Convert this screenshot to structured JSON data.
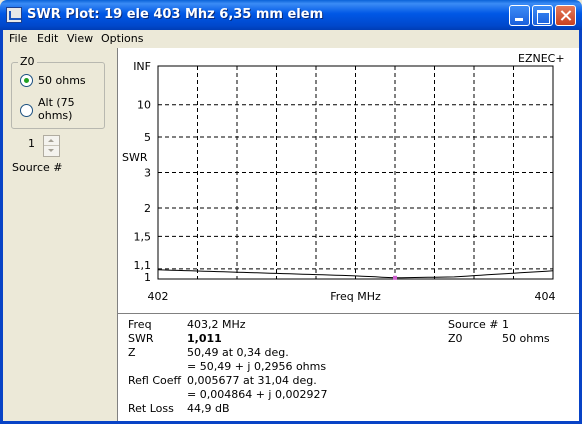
{
  "window": {
    "title": "SWR Plot: 19 ele 403 Mhz  6,35 mm elem"
  },
  "menu": [
    "File",
    "Edit",
    "View",
    "Options"
  ],
  "z0_panel": {
    "group_label": "Z0",
    "option1": "50 ohms",
    "option2_line1": "Alt (75",
    "option2_line2": "ohms)",
    "selected": "50 ohms"
  },
  "source": {
    "value": "1",
    "label": "Source #"
  },
  "chart_data": {
    "type": "line",
    "watermark": "EZNEC+",
    "xlabel": "Freq MHz",
    "ylabel": "SWR",
    "x_tick_labels": [
      "402",
      "404"
    ],
    "xlim": [
      402,
      404
    ],
    "y_scale": "reflection-coefficient",
    "y_ticks": [
      "INF",
      "10",
      "5",
      "3",
      "2",
      "1,5",
      "1,1",
      "1"
    ],
    "grid": true,
    "series": [
      {
        "x": [
          402.0,
          402.5,
          403.0,
          403.2,
          403.5,
          404.0
        ],
        "y": [
          1.09,
          1.06,
          1.03,
          1.011,
          1.02,
          1.08
        ]
      }
    ],
    "marker": {
      "x": 403.2,
      "y": 1.011,
      "color": "#d060d0"
    }
  },
  "info": {
    "freq_label": "Freq",
    "freq_value": "403,2 MHz",
    "swr_label": "SWR",
    "swr_value": "1,011",
    "z_label": "Z",
    "z_value1": "50,49 at 0,34 deg.",
    "z_value2": "= 50,49 + j 0,2956 ohms",
    "refl_label": "Refl Coeff",
    "refl_value1": "0,005677 at 31,04 deg.",
    "refl_value2": "= 0,004864 + j 0,002927",
    "retloss_label": "Ret Loss",
    "retloss_value": "44,9 dB",
    "source_label": "Source #",
    "source_value": "1",
    "z0_label": "Z0",
    "z0_value": "50 ohms"
  }
}
